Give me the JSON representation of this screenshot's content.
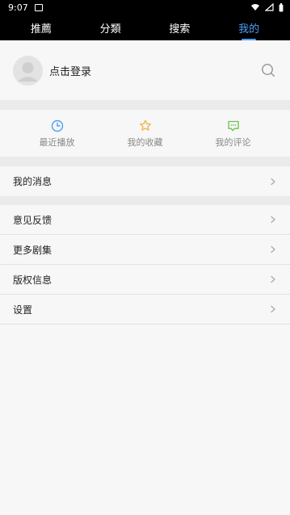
{
  "statusbar": {
    "time": "9:07"
  },
  "tabs": [
    {
      "label": "推薦"
    },
    {
      "label": "分類"
    },
    {
      "label": "搜索"
    },
    {
      "label": "我的"
    }
  ],
  "profile": {
    "login_label": "点击登录"
  },
  "quick_actions": [
    {
      "label": "最近播放",
      "icon": "clock-icon",
      "color": "#4f9ff7"
    },
    {
      "label": "我的收藏",
      "icon": "star-icon",
      "color": "#f0b44b"
    },
    {
      "label": "我的评论",
      "icon": "comment-icon",
      "color": "#6cc24a"
    }
  ],
  "menu": {
    "messages_label": "我的消息",
    "feedback_label": "意见反馈",
    "more_series_label": "更多剧集",
    "copyright_label": "版权信息",
    "settings_label": "设置"
  }
}
